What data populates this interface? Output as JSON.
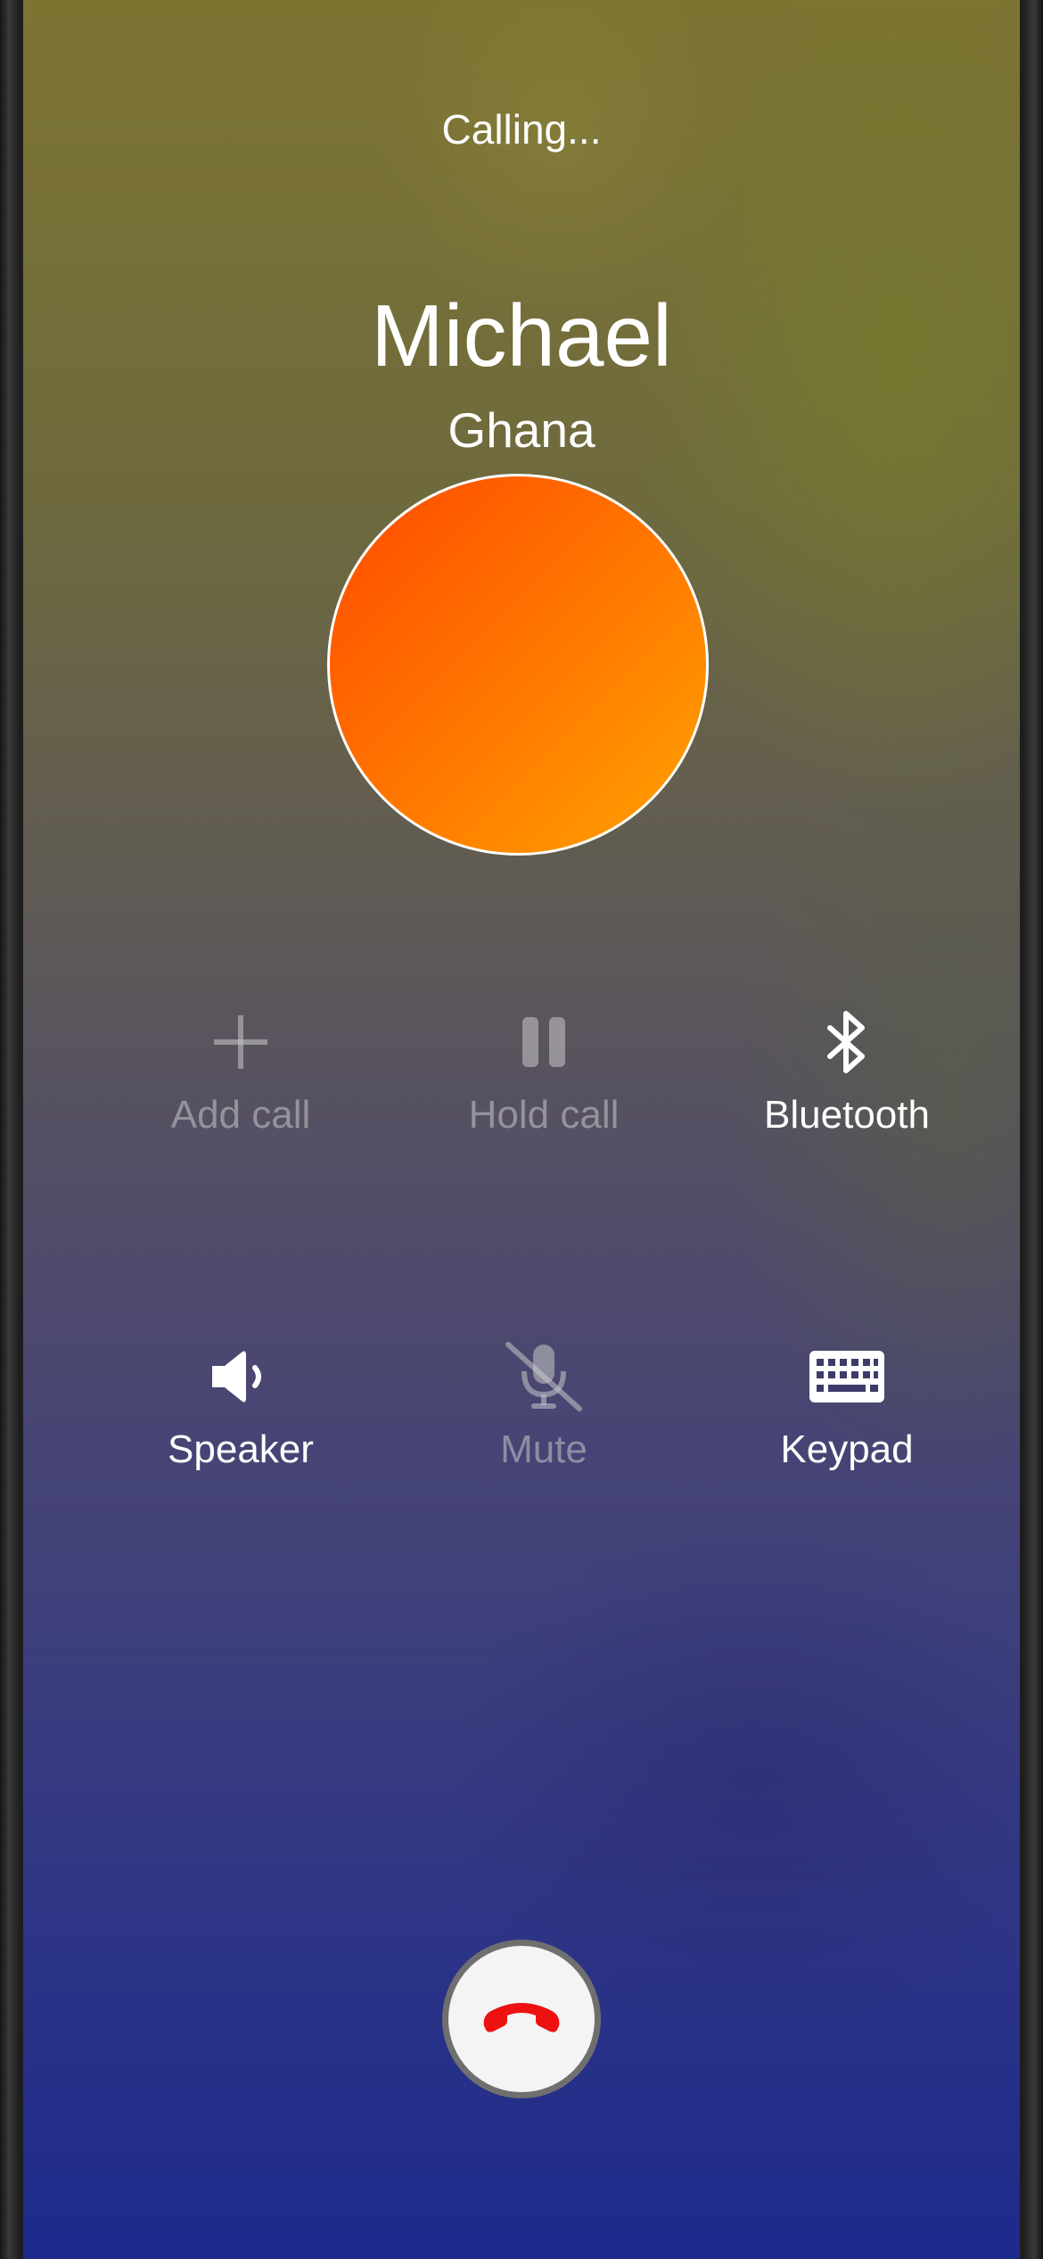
{
  "call": {
    "status": "Calling...",
    "contact_name": "Michael",
    "contact_location": "Ghana"
  },
  "actions": {
    "add_call": {
      "label": "Add call",
      "icon": "plus-icon",
      "enabled": false
    },
    "hold_call": {
      "label": "Hold call",
      "icon": "pause-icon",
      "enabled": false
    },
    "bluetooth": {
      "label": "Bluetooth",
      "icon": "bluetooth-icon",
      "enabled": true
    },
    "speaker": {
      "label": "Speaker",
      "icon": "speaker-icon",
      "enabled": true
    },
    "mute": {
      "label": "Mute",
      "icon": "microphone-muted-icon",
      "enabled": false
    },
    "keypad": {
      "label": "Keypad",
      "icon": "keyboard-icon",
      "enabled": true
    }
  },
  "end_call": {
    "icon": "phone-hangup-icon"
  },
  "colors": {
    "avatar_gradient_start": "#ff4a00",
    "avatar_gradient_end": "#ffa300",
    "end_call_icon": "#ee1111",
    "background_top": "#7d7432",
    "background_bottom": "#1d2a8c"
  }
}
